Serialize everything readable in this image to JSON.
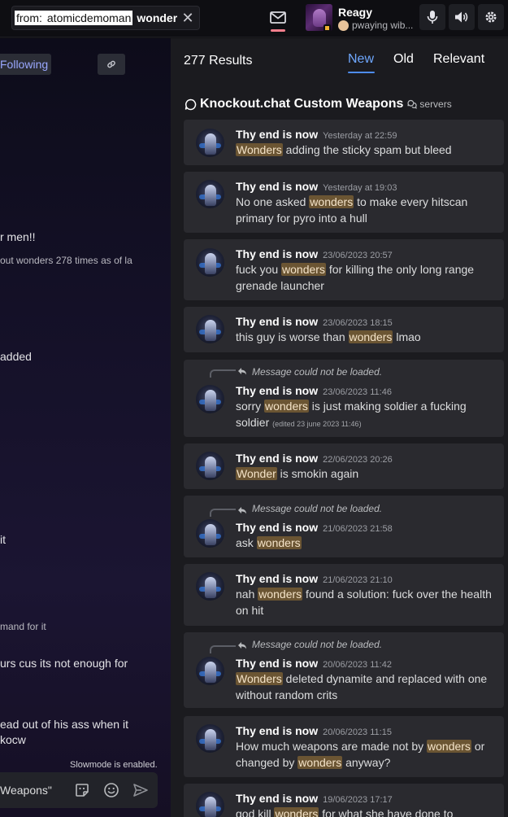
{
  "search": {
    "filter_key": "from:",
    "filter_value": "atomicdemoman",
    "query": "wonder"
  },
  "user": {
    "name": "Reagy",
    "status_text": "pwaying wib...",
    "status_color": "#f0b132"
  },
  "left": {
    "following_label": "Following",
    "fragments": [
      {
        "text": "r men!!",
        "small": false
      },
      {
        "text": "out wonders 278 times as of la",
        "small": true
      },
      {
        "text": " added",
        "small": false
      },
      {
        "text": "it",
        "small": false
      },
      {
        "text": "mand for it",
        "small": true
      },
      {
        "text": "urs cus its not enough for",
        "small": false
      },
      {
        "text": "ead out of his ass when it",
        "small": false
      },
      {
        "text": "kocw",
        "small": false
      }
    ],
    "slowmode": "Slowmode is enabled.",
    "composer_text": "Weapons\""
  },
  "results": {
    "count_label": "277 Results",
    "tabs": [
      {
        "label": "New",
        "active": true
      },
      {
        "label": "Old",
        "active": false
      },
      {
        "label": "Relevant",
        "active": false
      }
    ],
    "channel": "Knockout.chat Custom Weapons",
    "server_tag": "servers",
    "reply_placeholder": "Message could not be loaded.",
    "messages": [
      {
        "author": "Thy end is now",
        "time": "Yesterday at 22:59",
        "text_before": "",
        "hl1": "Wonders",
        "text_mid": " adding the sticky spam but bleed",
        "hl2": "",
        "text_after": ""
      },
      {
        "author": "Thy end is now",
        "time": "Yesterday at 19:03",
        "text_before": "No one asked ",
        "hl1": "wonders",
        "text_mid": " to make every hitscan primary for pyro into a hull",
        "hl2": "",
        "text_after": ""
      },
      {
        "author": "Thy end is now",
        "time": "23/06/2023 20:57",
        "text_before": "fuck you ",
        "hl1": "wonders",
        "text_mid": " for killing the only long range grenade launcher",
        "hl2": "",
        "text_after": ""
      },
      {
        "author": "Thy end is now",
        "time": "23/06/2023 18:15",
        "text_before": "this guy is worse than ",
        "hl1": "wonders",
        "text_mid": " lmao",
        "hl2": "",
        "text_after": ""
      },
      {
        "author": "Thy end is now",
        "time": "23/06/2023 11:46",
        "text_before": "sorry ",
        "hl1": "wonders",
        "text_mid": " is just making soldier a fucking soldier",
        "hl2": "",
        "text_after": "",
        "edited": "(edited 23 june 2023 11:46)"
      },
      {
        "author": "Thy end is now",
        "time": "22/06/2023 20:26",
        "text_before": "",
        "hl1": "Wonder",
        "text_mid": " is smokin again",
        "hl2": "",
        "text_after": ""
      },
      {
        "author": "Thy end is now",
        "time": "21/06/2023 21:58",
        "text_before": "ask ",
        "hl1": "wonders",
        "text_mid": "",
        "hl2": "",
        "text_after": ""
      },
      {
        "author": "Thy end is now",
        "time": "21/06/2023 21:10",
        "text_before": "nah ",
        "hl1": "wonders",
        "text_mid": " found a solution: fuck over the health on hit",
        "hl2": "",
        "text_after": ""
      },
      {
        "author": "Thy end is now",
        "time": "20/06/2023 11:42",
        "text_before": "",
        "hl1": "Wonders",
        "text_mid": " deleted dynamite and replaced with one without random crits",
        "hl2": "",
        "text_after": ""
      },
      {
        "author": "Thy end is now",
        "time": "20/06/2023 11:15",
        "text_before": "How much weapons are made not by ",
        "hl1": "wonders",
        "text_mid": " or changed by ",
        "hl2": "wonders",
        "text_after": " anyway?"
      },
      {
        "author": "Thy end is now",
        "time": "19/06/2023 17:17",
        "text_before": "god kill ",
        "hl1": "wonders",
        "text_mid": " for what she have done to",
        "hl2": "",
        "text_after": ""
      }
    ]
  },
  "colors": {
    "accent": "#6fa8ff",
    "highlight": "#6b5533",
    "inbox_unread": "#f47e8c"
  }
}
